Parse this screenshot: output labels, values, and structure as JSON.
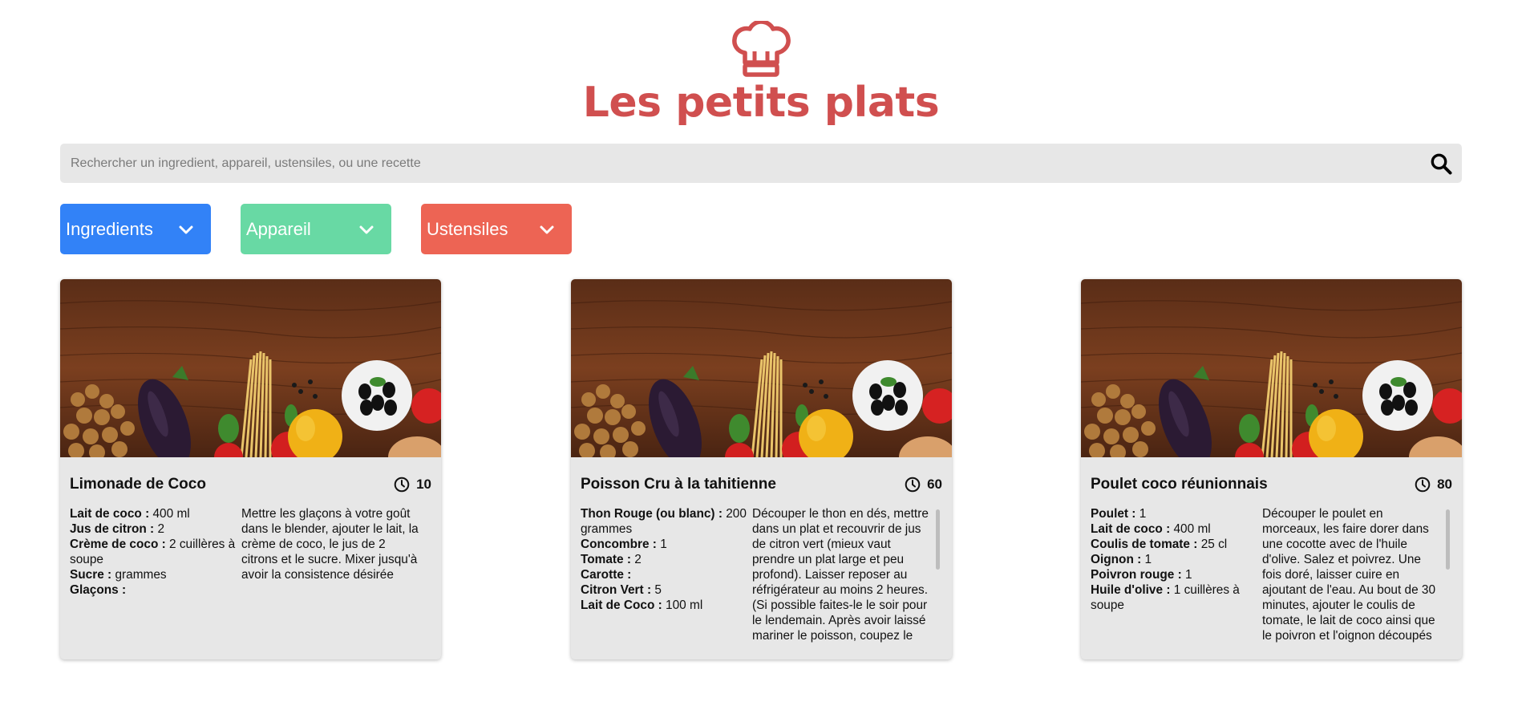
{
  "header": {
    "title": "Les petits plats",
    "logo_icon": "chef-hat-icon",
    "brand_color": "#D04F4F"
  },
  "search": {
    "placeholder": "Rechercher un ingredient, appareil, ustensiles, ou une recette",
    "value": "",
    "icon": "search-icon"
  },
  "filters": [
    {
      "label": "Ingredients",
      "color": "#3282F7",
      "icon": "chevron-down-icon"
    },
    {
      "label": "Appareil",
      "color": "#68D9A4",
      "icon": "chevron-down-icon"
    },
    {
      "label": "Ustensiles",
      "color": "#ED6454",
      "icon": "chevron-down-icon"
    }
  ],
  "recipes": [
    {
      "title": "Limonade de Coco",
      "time": "10",
      "ingredients": [
        {
          "name": "Lait de coco :",
          "qty": "400 ml"
        },
        {
          "name": "Jus de citron :",
          "qty": "2"
        },
        {
          "name": "Crème de coco :",
          "qty": "2 cuillères à soupe"
        },
        {
          "name": "Sucre :",
          "qty": "grammes"
        },
        {
          "name": "Glaçons :",
          "qty": ""
        }
      ],
      "description": "Mettre les glaçons à votre goût dans le blender, ajouter le lait, la crème de coco, le jus de 2 citrons et le sucre. Mixer jusqu'à avoir la consistence désirée"
    },
    {
      "title": "Poisson Cru à la tahitienne",
      "time": "60",
      "ingredients": [
        {
          "name": "Thon Rouge (ou blanc) :",
          "qty": "200 grammes"
        },
        {
          "name": "Concombre :",
          "qty": "1"
        },
        {
          "name": "Tomate :",
          "qty": "2"
        },
        {
          "name": "Carotte :",
          "qty": ""
        },
        {
          "name": "Citron Vert :",
          "qty": "5"
        },
        {
          "name": "Lait de Coco :",
          "qty": "100 ml"
        }
      ],
      "description": "Découper le thon en dés, mettre dans un plat et recouvrir de jus de citron vert (mieux vaut prendre un plat large et peu profond). Laisser reposer au réfrigérateur au moins 2 heures. (Si possible faites-le le soir pour le lendemain. Après avoir laissé mariner le poisson, coupez le"
    },
    {
      "title": "Poulet coco réunionnais",
      "time": "80",
      "ingredients": [
        {
          "name": "Poulet :",
          "qty": "1"
        },
        {
          "name": "Lait de coco :",
          "qty": "400 ml"
        },
        {
          "name": "Coulis de tomate :",
          "qty": "25 cl"
        },
        {
          "name": "Oignon :",
          "qty": "1"
        },
        {
          "name": "Poivron rouge :",
          "qty": "1"
        },
        {
          "name": "Huile d'olive :",
          "qty": "1 cuillères à soupe"
        }
      ],
      "description": "Découper le poulet en morceaux, les faire dorer dans une cocotte avec de l'huile d'olive. Salez et poivrez. Une fois doré, laisser cuire en ajoutant de l'eau. Au bout de 30 minutes, ajouter le coulis de tomate, le lait de coco ainsi que le poivron et l'oignon découpés"
    }
  ]
}
